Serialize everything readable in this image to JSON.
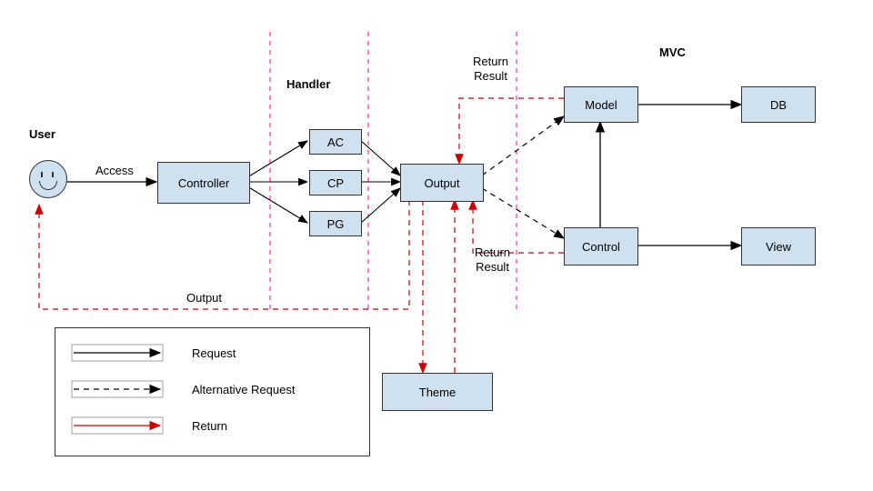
{
  "title_user": "User",
  "title_handler": "Handler",
  "title_mvc": "MVC",
  "nodes": {
    "controller": "Controller",
    "ac": "AC",
    "cp": "CP",
    "pg": "PG",
    "output": "Output",
    "model": "Model",
    "control": "Control",
    "db": "DB",
    "view": "View",
    "theme": "Theme"
  },
  "edge_labels": {
    "access": "Access",
    "output": "Output",
    "return_result_top": "Return\nResult",
    "return_result_bottom": "Return\nResult"
  },
  "legend": {
    "request": "Request",
    "alt": "Alternative Request",
    "ret": "Return"
  },
  "colors": {
    "block": "#cfe0ef",
    "magenta": "#ff33cc",
    "red": "#cc0000",
    "black": "#000000"
  }
}
